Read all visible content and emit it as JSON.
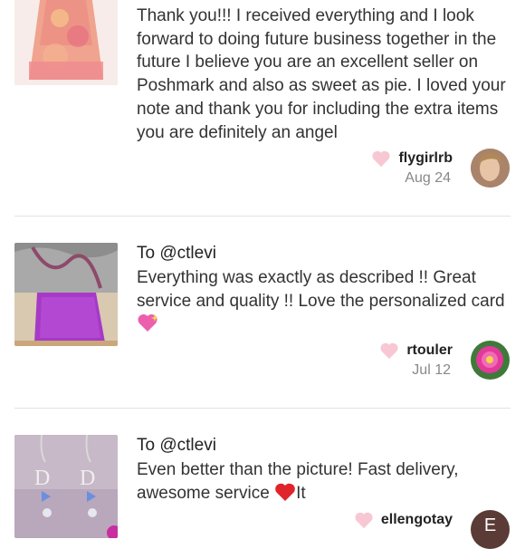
{
  "reviews": [
    {
      "to": "",
      "text": "Thank you!!! I received everything and I look forward to doing future business together in the future I believe you are an excellent seller on Poshmark and also as sweet as pie. I loved your note and thank you for including the extra items you are definitely an angel",
      "username": "flygirlrb",
      "date": "Aug 24"
    },
    {
      "to": "To @ctlevi",
      "text": "Everything was exactly as described !! Great service and quality !! Love the personalized card",
      "emoji": "sparkling-heart",
      "username": "rtouler",
      "date": "Jul 12"
    },
    {
      "to": "To @ctlevi",
      "text_before": "Even better than the picture! Fast delivery, awesome service",
      "emoji": "red-heart",
      "text_after": "It",
      "username": "ellengotay",
      "avatar_letter": "E"
    }
  ],
  "colors": {
    "heart": "#f7c8d3",
    "divider": "#e2e2e2",
    "avatar_bg": "#5a3b36"
  }
}
